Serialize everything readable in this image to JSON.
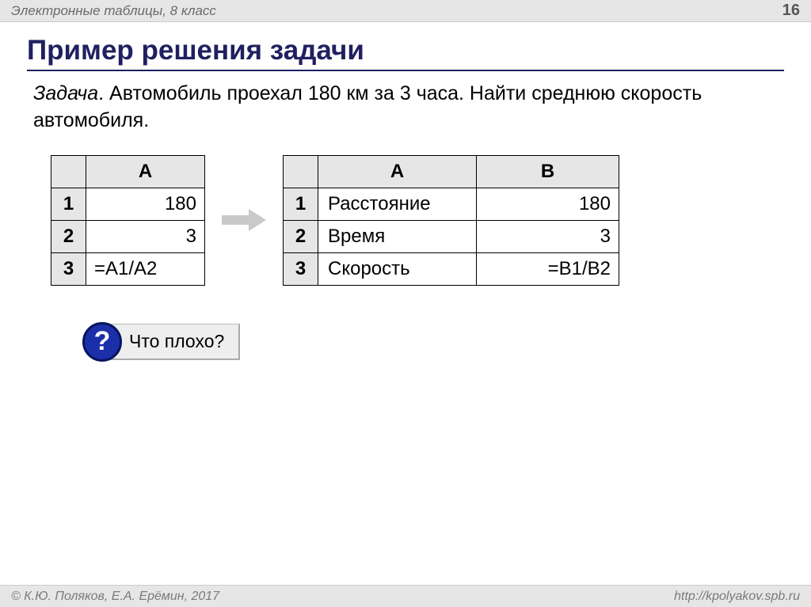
{
  "header": {
    "subject": "Электронные таблицы, 8 класс",
    "page_number": "16"
  },
  "title": "Пример решения задачи",
  "problem": {
    "label": "Задача",
    "text": ". Автомобиль проехал 180 км за 3 часа. Найти среднюю скорость автомобиля."
  },
  "table1": {
    "col_headers": [
      "A"
    ],
    "rows": [
      {
        "n": "1",
        "val": "180"
      },
      {
        "n": "2",
        "val": "3"
      },
      {
        "n": "3",
        "val": "=A1/A2"
      }
    ]
  },
  "table2": {
    "col_headers": [
      "A",
      "B"
    ],
    "rows": [
      {
        "n": "1",
        "a": "Расстояние",
        "b": "180"
      },
      {
        "n": "2",
        "a": "Время",
        "b": "3"
      },
      {
        "n": "3",
        "a": "Скорость",
        "b": "=B1/B2"
      }
    ]
  },
  "question": {
    "mark": "?",
    "text": "Что плохо?"
  },
  "footer": {
    "copyright": "© К.Ю. Поляков, Е.А. Ерёмин, 2017",
    "url": "http://kpolyakov.spb.ru"
  }
}
